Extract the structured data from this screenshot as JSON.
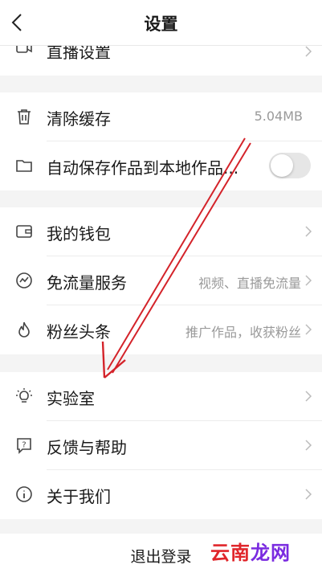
{
  "header": {
    "title": "设置"
  },
  "rows": {
    "live": {
      "label": "直播设置"
    },
    "cache": {
      "label": "清除缓存",
      "value": "5.04MB"
    },
    "autosave": {
      "label": "自动保存作品到本地作品...",
      "enabled": false
    },
    "wallet": {
      "label": "我的钱包"
    },
    "dataplan": {
      "label": "免流量服务",
      "value": "视频、直播免流量"
    },
    "fans": {
      "label": "粉丝头条",
      "value": "推广作品，收获粉丝"
    },
    "lab": {
      "label": "实验室"
    },
    "feedback": {
      "label": "反馈与帮助"
    },
    "about": {
      "label": "关于我们"
    }
  },
  "logout": {
    "label": "退出登录"
  },
  "watermark": {
    "text": "云南",
    "text2": "龙网"
  },
  "colors": {
    "arrow": "#d4232a",
    "watermark": "#e0262b"
  }
}
